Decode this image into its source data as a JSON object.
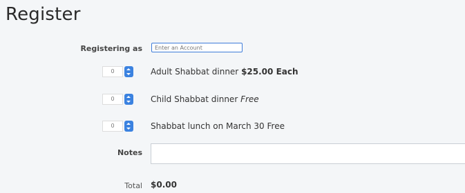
{
  "page_title": "Register",
  "registering_as": {
    "label": "Registering as",
    "placeholder": "Enter an Account"
  },
  "items": [
    {
      "quantity": "0",
      "name": "Adult Shabbat dinner",
      "price": "$25.00 Each"
    },
    {
      "quantity": "0",
      "name": "Child Shabbat dinner",
      "price": "Free"
    },
    {
      "quantity": "0",
      "name": "Shabbat lunch on March 30",
      "price": "Free"
    }
  ],
  "notes": {
    "label": "Notes",
    "value": ""
  },
  "total": {
    "label": "Total",
    "value": "$0.00"
  },
  "colors": {
    "accent": "#3b82e0",
    "panel_bg": "#f4f6f8"
  }
}
